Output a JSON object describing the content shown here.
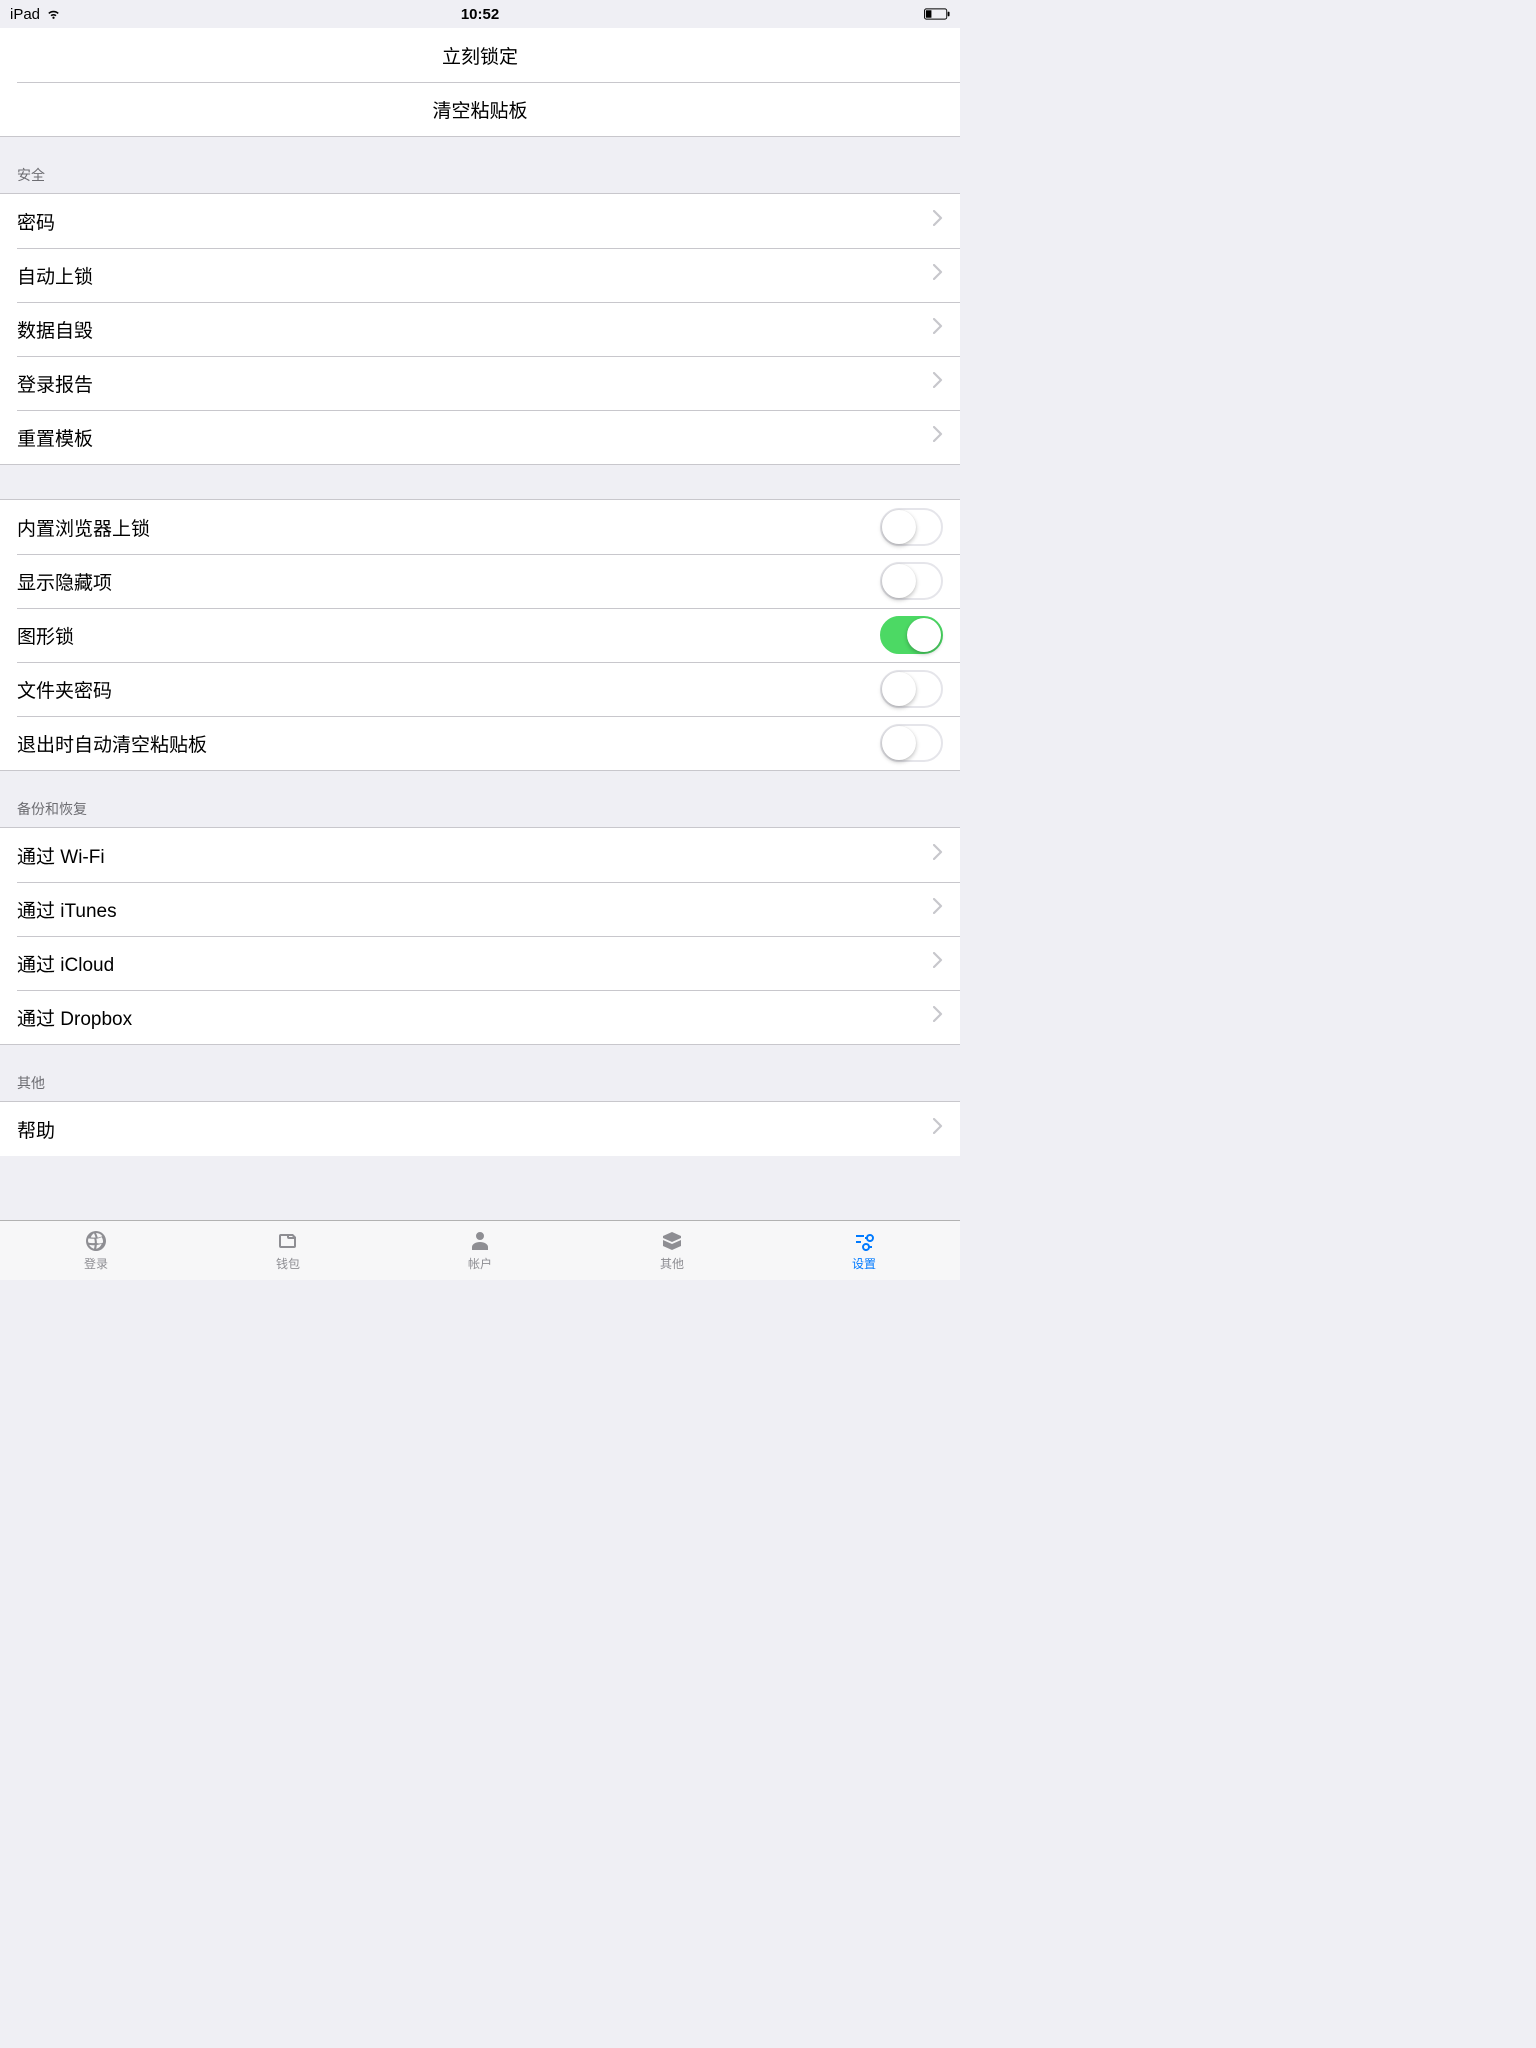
{
  "status_bar": {
    "device": "iPad",
    "time": "10:52"
  },
  "top_actions": {
    "lock_now": "立刻锁定",
    "clear_clipboard": "清空粘贴板"
  },
  "security": {
    "header": "安全",
    "password": "密码",
    "auto_lock": "自动上锁",
    "data_destroy": "数据自毁",
    "login_report": "登录报告",
    "reset_template": "重置模板"
  },
  "toggles": {
    "browser_lock": "内置浏览器上锁",
    "show_hidden": "显示隐藏项",
    "pattern_lock": "图形锁",
    "folder_password": "文件夹密码",
    "auto_clear_clipboard": "退出时自动清空粘贴板",
    "states": {
      "browser_lock": false,
      "show_hidden": false,
      "pattern_lock": true,
      "folder_password": false,
      "auto_clear_clipboard": false
    }
  },
  "backup": {
    "header": "备份和恢复",
    "wifi": "通过 Wi-Fi",
    "itunes": "通过 iTunes",
    "icloud": "通过 iCloud",
    "dropbox": "通过 Dropbox"
  },
  "other": {
    "header": "其他",
    "help": "帮助"
  },
  "tabs": {
    "login": "登录",
    "wallet": "钱包",
    "account": "帐户",
    "others": "其他",
    "settings": "设置"
  }
}
